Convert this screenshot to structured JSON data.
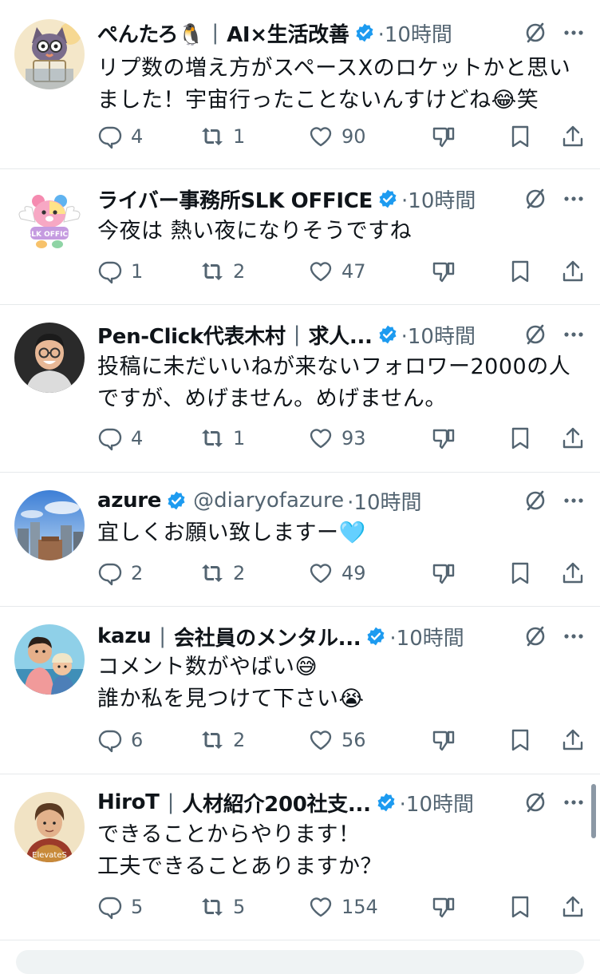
{
  "posts": [
    {
      "name": "ぺんたろ🐧",
      "name_extra": "AI×生活改善",
      "handle": "",
      "time": "·10時間",
      "lines": [
        "リプ数の増え方がスペースXのロケットかと思い",
        "ました！宇宙行ったことないんすけどね😂笑"
      ],
      "replies": "4",
      "reposts": "1",
      "likes": "90",
      "avatar": "cartoon-character-reading-book"
    },
    {
      "name": "ライバー事務所SLK OFFICE",
      "name_extra": "",
      "handle": "",
      "time": "·10時間",
      "lines": [
        "今夜は 熱い夜になりそうですね"
      ],
      "replies": "1",
      "reposts": "2",
      "likes": "47",
      "avatar": "winged-teddy-bear-logo",
      "avatar_text": "SLK OFFICE"
    },
    {
      "name": "Pen-Click代表木村",
      "name_extra": "求人...",
      "handle": "",
      "time": "·10時間",
      "lines": [
        "投稿に未だいいねが来ないフォロワー2000の人",
        "ですが、めげません。めげません。"
      ],
      "replies": "4",
      "reposts": "1",
      "likes": "93",
      "avatar": "smiling-man-with-glasses"
    },
    {
      "name": "azure",
      "name_extra": "",
      "handle": "@diaryofazure",
      "time": "·10時間",
      "lines": [
        "宜しくお願い致しますー🩵"
      ],
      "replies": "2",
      "reposts": "2",
      "likes": "49",
      "avatar": "city-skyline-photo"
    },
    {
      "name": "kazu",
      "name_extra": "会社員のメンタル...",
      "handle": "",
      "time": "·10時間",
      "lines": [
        "コメント数がやばい😅",
        "誰か私を見つけて下さい😭"
      ],
      "replies": "6",
      "reposts": "2",
      "likes": "56",
      "avatar": "illustrated-father-and-child"
    },
    {
      "name": "HiroT",
      "name_extra": "人材紹介200社支...",
      "handle": "",
      "time": "·10時間",
      "lines": [
        "できることからやります！",
        "工夫できることありますか？"
      ],
      "replies": "5",
      "reposts": "5",
      "likes": "154",
      "avatar": "illustrated-warrior-portrait",
      "avatar_text": "ElevateS"
    }
  ],
  "icons": {
    "reply": "speech-bubble-icon",
    "repost": "repost-arrows-icon",
    "like": "heart-icon",
    "dislike": "thumbs-down-icon",
    "bookmark": "bookmark-icon",
    "share": "share-upload-icon",
    "grok": "slashed-circle-icon",
    "more": "more-dots-icon",
    "verified": "verified-badge-icon"
  },
  "colors": {
    "text": "#0f1419",
    "secondary": "#536471",
    "verified": "#1d9bf0",
    "divider": "#e6e9eb"
  }
}
